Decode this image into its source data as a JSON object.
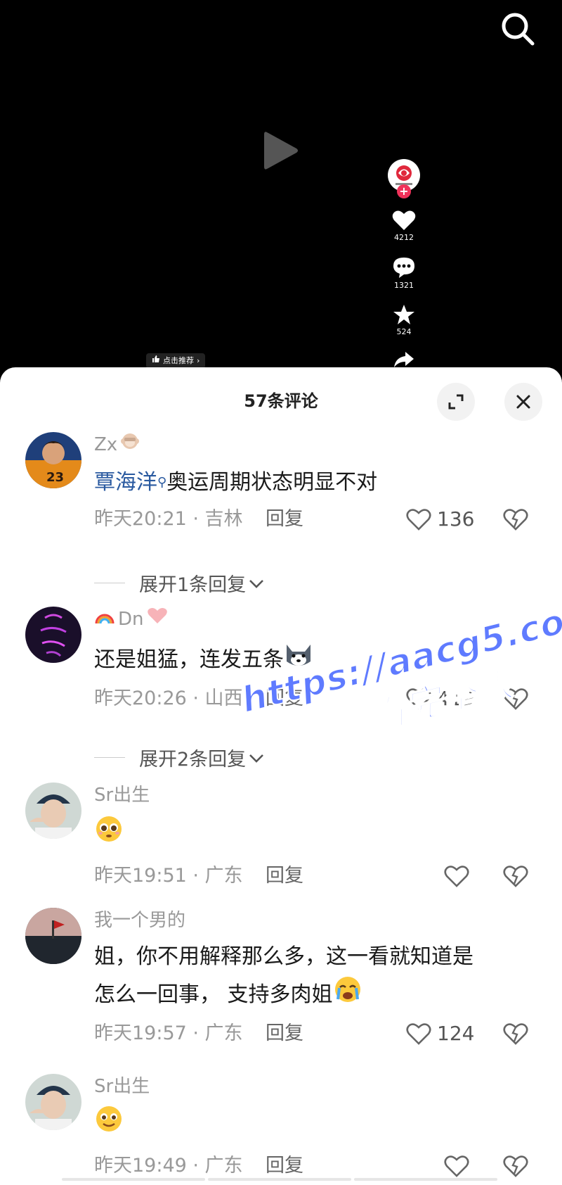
{
  "video": {
    "search_icon": "search-icon",
    "play_icon": "play-icon",
    "likes": "4212",
    "comments": "1321",
    "favorites": "524",
    "recommend_label": "点击推荐"
  },
  "sheet": {
    "title": "57条评论"
  },
  "comments": [
    {
      "user": "Zx",
      "mention": "覃海洋",
      "text": "奥运周期状态明显不对",
      "time_location": "昨天20:21 · 吉林",
      "reply": "回复",
      "likes": "136",
      "expand": "展开1条回复"
    },
    {
      "user": "Dn",
      "text": "还是姐猛，连发五条",
      "time_location": "昨天20:26 · 山西",
      "reply": "回复",
      "likes": "419",
      "expand": "展开2条回复"
    },
    {
      "user": "Sr出生",
      "text": "",
      "time_location": "昨天19:51 · 广东",
      "reply": "回复",
      "likes": ""
    },
    {
      "user": "我一个男的",
      "text_line1": "姐，你不用解释那么多，这一看就知道是",
      "text_line2": "怎么一回事， 支持多肉姐",
      "time_location": "昨天19:57 · 广东",
      "reply": "回复",
      "likes": "124"
    },
    {
      "user": "Sr出生",
      "text": "",
      "time_location": "昨天19:49 · 广东",
      "reply": "回复",
      "likes": ""
    }
  ],
  "watermark": {
    "line1": "https://aacg5.com",
    "line2": "看完整版"
  }
}
